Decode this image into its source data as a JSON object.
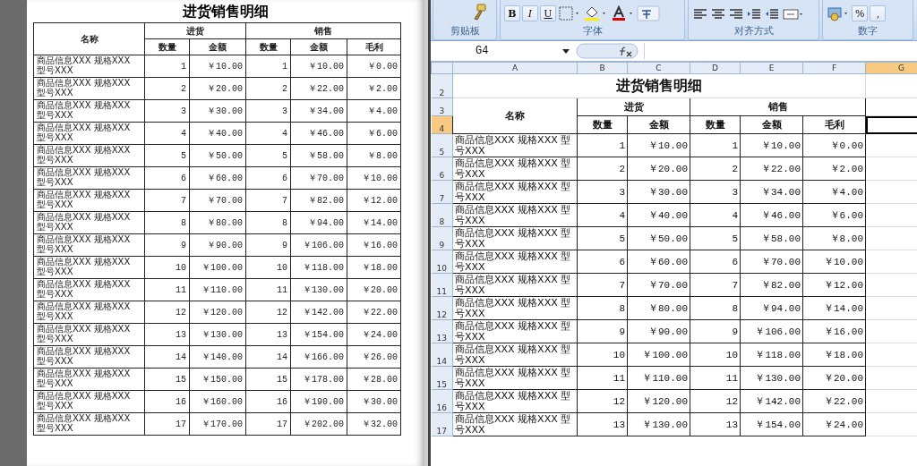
{
  "print_preview": {
    "title": "进货销售明细",
    "name_header": "名称",
    "purchase_header": "进货",
    "sale_header": "销售",
    "columns": [
      "数量",
      "金额",
      "数量",
      "金额",
      "毛利"
    ],
    "rows": [
      {
        "name": "商品信息XXX 规格XXX 型号XXX",
        "purchase_qty": "1",
        "purchase_amount": "￥10.00",
        "sale_qty": "1",
        "sale_amount": "￥10.00",
        "profit": "￥0.00"
      },
      {
        "name": "商品信息XXX 规格XXX 型号XXX",
        "purchase_qty": "2",
        "purchase_amount": "￥20.00",
        "sale_qty": "2",
        "sale_amount": "￥22.00",
        "profit": "￥2.00"
      },
      {
        "name": "商品信息XXX 规格XXX 型号XXX",
        "purchase_qty": "3",
        "purchase_amount": "￥30.00",
        "sale_qty": "3",
        "sale_amount": "￥34.00",
        "profit": "￥4.00"
      },
      {
        "name": "商品信息XXX 规格XXX 型号XXX",
        "purchase_qty": "4",
        "purchase_amount": "￥40.00",
        "sale_qty": "4",
        "sale_amount": "￥46.00",
        "profit": "￥6.00"
      },
      {
        "name": "商品信息XXX 规格XXX 型号XXX",
        "purchase_qty": "5",
        "purchase_amount": "￥50.00",
        "sale_qty": "5",
        "sale_amount": "￥58.00",
        "profit": "￥8.00"
      },
      {
        "name": "商品信息XXX 规格XXX 型号XXX",
        "purchase_qty": "6",
        "purchase_amount": "￥60.00",
        "sale_qty": "6",
        "sale_amount": "￥70.00",
        "profit": "￥10.00"
      },
      {
        "name": "商品信息XXX 规格XXX 型号XXX",
        "purchase_qty": "7",
        "purchase_amount": "￥70.00",
        "sale_qty": "7",
        "sale_amount": "￥82.00",
        "profit": "￥12.00"
      },
      {
        "name": "商品信息XXX 规格XXX 型号XXX",
        "purchase_qty": "8",
        "purchase_amount": "￥80.00",
        "sale_qty": "8",
        "sale_amount": "￥94.00",
        "profit": "￥14.00"
      },
      {
        "name": "商品信息XXX 规格XXX 型号XXX",
        "purchase_qty": "9",
        "purchase_amount": "￥90.00",
        "sale_qty": "9",
        "sale_amount": "￥106.00",
        "profit": "￥16.00"
      },
      {
        "name": "商品信息XXX 规格XXX 型号XXX",
        "purchase_qty": "10",
        "purchase_amount": "￥100.00",
        "sale_qty": "10",
        "sale_amount": "￥118.00",
        "profit": "￥18.00"
      },
      {
        "name": "商品信息XXX 规格XXX 型号XXX",
        "purchase_qty": "11",
        "purchase_amount": "￥110.00",
        "sale_qty": "11",
        "sale_amount": "￥130.00",
        "profit": "￥20.00"
      },
      {
        "name": "商品信息XXX 规格XXX 型号XXX",
        "purchase_qty": "12",
        "purchase_amount": "￥120.00",
        "sale_qty": "12",
        "sale_amount": "￥142.00",
        "profit": "￥22.00"
      },
      {
        "name": "商品信息XXX 规格XXX 型号XXX",
        "purchase_qty": "13",
        "purchase_amount": "￥130.00",
        "sale_qty": "13",
        "sale_amount": "￥154.00",
        "profit": "￥24.00"
      },
      {
        "name": "商品信息XXX 规格XXX 型号XXX",
        "purchase_qty": "14",
        "purchase_amount": "￥140.00",
        "sale_qty": "14",
        "sale_amount": "￥166.00",
        "profit": "￥26.00"
      },
      {
        "name": "商品信息XXX 规格XXX 型号XXX",
        "purchase_qty": "15",
        "purchase_amount": "￥150.00",
        "sale_qty": "15",
        "sale_amount": "￥178.00",
        "profit": "￥28.00"
      },
      {
        "name": "商品信息XXX 规格XXX 型号XXX",
        "purchase_qty": "16",
        "purchase_amount": "￥160.00",
        "sale_qty": "16",
        "sale_amount": "￥190.00",
        "profit": "￥30.00"
      },
      {
        "name": "商品信息XXX 规格XXX 型号XXX",
        "purchase_qty": "17",
        "purchase_amount": "￥170.00",
        "sale_qty": "17",
        "sale_amount": "￥202.00",
        "profit": "￥32.00"
      }
    ]
  },
  "spreadsheet": {
    "ribbon": {
      "font_buttons": [
        "B",
        "I",
        "U"
      ],
      "number_buttons": [
        "%",
        ","
      ],
      "groups": [
        "剪贴板",
        "字体",
        "对齐方式",
        "数字"
      ]
    },
    "name_box": "G4",
    "column_headers": [
      {
        "label": "A",
        "selected": false
      },
      {
        "label": "B",
        "selected": false
      },
      {
        "label": "C",
        "selected": false
      },
      {
        "label": "D",
        "selected": false
      },
      {
        "label": "E",
        "selected": false
      },
      {
        "label": "F",
        "selected": false
      },
      {
        "label": "G",
        "selected": true
      }
    ],
    "row_numbers": [
      {
        "label": "2",
        "selected": false
      },
      {
        "label": "3",
        "selected": false
      },
      {
        "label": "4",
        "selected": true
      },
      {
        "label": "5",
        "selected": false
      },
      {
        "label": "6",
        "selected": false
      },
      {
        "label": "7",
        "selected": false
      },
      {
        "label": "8",
        "selected": false
      },
      {
        "label": "9",
        "selected": false
      },
      {
        "label": "10",
        "selected": false
      },
      {
        "label": "11",
        "selected": false
      },
      {
        "label": "12",
        "selected": false
      },
      {
        "label": "13",
        "selected": false
      },
      {
        "label": "14",
        "selected": false
      },
      {
        "label": "15",
        "selected": false
      },
      {
        "label": "16",
        "selected": false
      },
      {
        "label": "17",
        "selected": false
      }
    ],
    "title": "进货销售明细",
    "name_header": "名称",
    "purchase_header": "进货",
    "sale_header": "销售",
    "columns": [
      "数量",
      "金额",
      "数量",
      "金额",
      "毛利"
    ],
    "rows": [
      {
        "name": "商品信息XXX 规格XXX 型号XXX",
        "purchase_qty": "1",
        "purchase_amount": "￥10.00",
        "sale_qty": "1",
        "sale_amount": "￥10.00",
        "profit": "￥0.00"
      },
      {
        "name": "商品信息XXX 规格XXX 型号XXX",
        "purchase_qty": "2",
        "purchase_amount": "￥20.00",
        "sale_qty": "2",
        "sale_amount": "￥22.00",
        "profit": "￥2.00"
      },
      {
        "name": "商品信息XXX 规格XXX 型号XXX",
        "purchase_qty": "3",
        "purchase_amount": "￥30.00",
        "sale_qty": "3",
        "sale_amount": "￥34.00",
        "profit": "￥4.00"
      },
      {
        "name": "商品信息XXX 规格XXX 型号XXX",
        "purchase_qty": "4",
        "purchase_amount": "￥40.00",
        "sale_qty": "4",
        "sale_amount": "￥46.00",
        "profit": "￥6.00"
      },
      {
        "name": "商品信息XXX 规格XXX 型号XXX",
        "purchase_qty": "5",
        "purchase_amount": "￥50.00",
        "sale_qty": "5",
        "sale_amount": "￥58.00",
        "profit": "￥8.00"
      },
      {
        "name": "商品信息XXX 规格XXX 型号XXX",
        "purchase_qty": "6",
        "purchase_amount": "￥60.00",
        "sale_qty": "6",
        "sale_amount": "￥70.00",
        "profit": "￥10.00"
      },
      {
        "name": "商品信息XXX 规格XXX 型号XXX",
        "purchase_qty": "7",
        "purchase_amount": "￥70.00",
        "sale_qty": "7",
        "sale_amount": "￥82.00",
        "profit": "￥12.00"
      },
      {
        "name": "商品信息XXX 规格XXX 型号XXX",
        "purchase_qty": "8",
        "purchase_amount": "￥80.00",
        "sale_qty": "8",
        "sale_amount": "￥94.00",
        "profit": "￥14.00"
      },
      {
        "name": "商品信息XXX 规格XXX 型号XXX",
        "purchase_qty": "9",
        "purchase_amount": "￥90.00",
        "sale_qty": "9",
        "sale_amount": "￥106.00",
        "profit": "￥16.00"
      },
      {
        "name": "商品信息XXX 规格XXX 型号XXX",
        "purchase_qty": "10",
        "purchase_amount": "￥100.00",
        "sale_qty": "10",
        "sale_amount": "￥118.00",
        "profit": "￥18.00"
      },
      {
        "name": "商品信息XXX 规格XXX 型号XXX",
        "purchase_qty": "11",
        "purchase_amount": "￥110.00",
        "sale_qty": "11",
        "sale_amount": "￥130.00",
        "profit": "￥20.00"
      },
      {
        "name": "商品信息XXX 规格XXX 型号XXX",
        "purchase_qty": "12",
        "purchase_amount": "￥120.00",
        "sale_qty": "12",
        "sale_amount": "￥142.00",
        "profit": "￥22.00"
      },
      {
        "name": "商品信息XXX 规格XXX 型号XXX",
        "purchase_qty": "13",
        "purchase_amount": "￥130.00",
        "sale_qty": "13",
        "sale_amount": "￥154.00",
        "profit": "￥24.00"
      }
    ]
  }
}
